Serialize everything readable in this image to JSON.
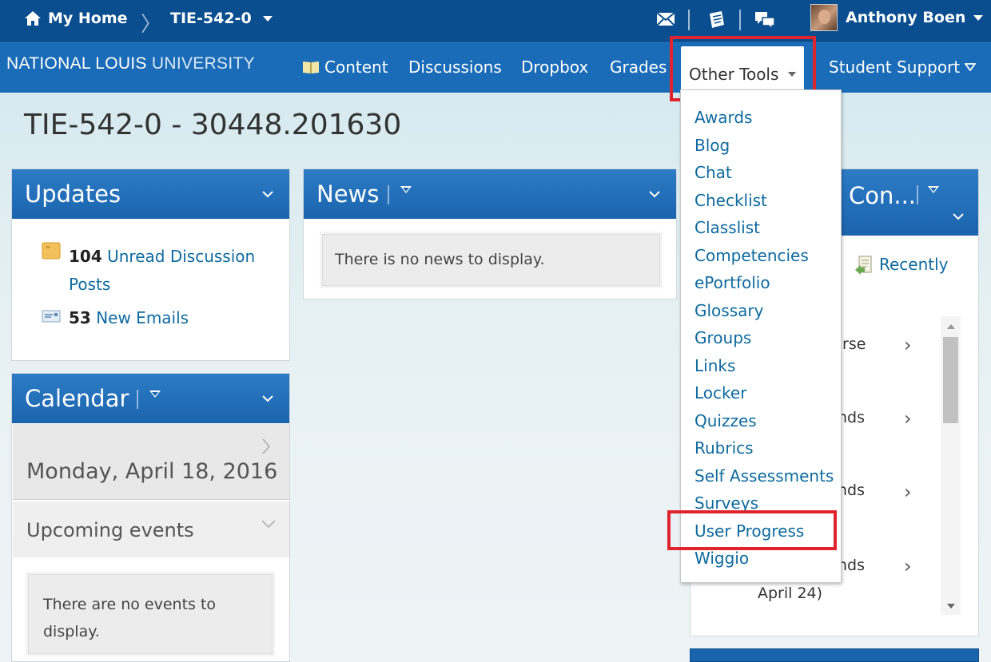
{
  "topbar": {
    "home_label": "My Home",
    "course_label": "TIE-542-0",
    "user_name": "Anthony Boen",
    "icons": [
      "home-icon",
      "mail-icon",
      "notebook-icon",
      "chat-icon"
    ]
  },
  "navbar": {
    "brand_bold": "NATIONAL LOUIS",
    "brand_thin": " UNIVERSITY",
    "items": [
      {
        "label": "Content",
        "icon": "book-icon"
      },
      {
        "label": "Discussions"
      },
      {
        "label": "Dropbox"
      },
      {
        "label": "Grades"
      },
      {
        "label": "Other Tools"
      },
      {
        "label": "Student Support"
      }
    ]
  },
  "page_title": "TIE-542-0 - 30448.201630",
  "updates": {
    "title": "Updates",
    "discussion_count": "104",
    "discussion_label_1": "Unread Discussion",
    "discussion_label_2": "Posts",
    "email_count": "53",
    "email_label": "New Emails"
  },
  "news": {
    "title": "News",
    "empty": "There is no news to display."
  },
  "calendar": {
    "title": "Calendar",
    "date": "Monday, April 18, 2016",
    "upcoming_title": "Upcoming events",
    "empty_1": "There are no events to",
    "empty_2": "display."
  },
  "content_widget": {
    "title": "Con...",
    "recently_label": "Recently",
    "rows": [
      "urse",
      "nds",
      "nds",
      "nds"
    ],
    "last_line": "April 24)"
  },
  "other_tools_menu": [
    "Awards",
    "Blog",
    "Chat",
    "Checklist",
    "Classlist",
    "Competencies",
    "ePortfolio",
    "Glossary",
    "Groups",
    "Links",
    "Locker",
    "Quizzes",
    "Rubrics",
    "Self Assessments",
    "Surveys",
    "User Progress",
    "Wiggio"
  ],
  "colors": {
    "topbar": "#0a4e8f",
    "navbar": "#1a6cb8",
    "link": "#0e6a9e",
    "highlight": "#e0242e"
  }
}
